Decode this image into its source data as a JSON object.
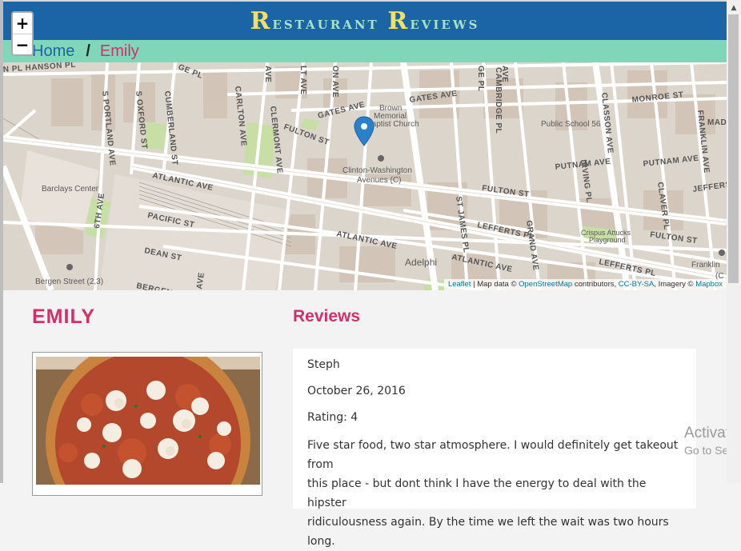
{
  "header": {
    "title_first_caps": [
      "R",
      "R"
    ],
    "title_rest": [
      "estaurant ",
      "eviews"
    ],
    "title": "Restaurant Reviews"
  },
  "breadcrumb": {
    "home": "Home",
    "separator": "/",
    "current": "Emily"
  },
  "map": {
    "zoom_in": "+",
    "zoom_out": "−",
    "attribution": {
      "leaflet": "Leaflet",
      "sep": "|",
      "data_prefix": "Map data ©",
      "osm": "OpenStreetMap",
      "contributors": "contributors,",
      "license": "CC-BY-SA",
      "imagery": ", Imagery ©",
      "provider": "Mapbox"
    },
    "marker_icon": "map-marker-icon",
    "streets": {
      "hanson": "N PL HANSON PL",
      "fulton_w": "FULTON ST",
      "fulton_c": "FULTON ST",
      "fulton_e": "FULTON ST",
      "atlantic_w": "ATLANTIC AVE",
      "atlantic_c": "ATLANTIC AVE",
      "atlantic_e": "ATLANTIC AVE",
      "gates_w": "GATES AVE",
      "gates_e": "GATES AVE",
      "monroe": "MONROE ST",
      "putnam_w": "PUTNAM AVE",
      "putnam_e": "PUTNAM AVE",
      "pacific": "PACIFIC ST",
      "dean": "DEAN ST",
      "bergen": "BERGEN",
      "lefferts_w": "LEFFERTS PL",
      "lefferts_e": "LEFFERTS PL",
      "jefferson": "JEFFERSO",
      "mad": "MAD",
      "s_portland": "S PORTLAND AVE",
      "s_oxford": "S OXFORD ST",
      "cumberland": "CUMBERLAND ST",
      "carlton": "CARLTON AVE",
      "clermont": "CLERMONT AVE",
      "vanderbilt": "VANDERBILT AVE",
      "lt_ave": "LT AVE",
      "on_ave": "ON AVE",
      "st_james": "ST JAMES PL",
      "cambridge": "CAMBRIDGE PL",
      "grand": "GRAND AVE",
      "irving": "IRVING PL",
      "classon": "CLASSON AVE",
      "claver": "CLAVER PL",
      "franklin_ave": "FRANKLIN AVE",
      "sixth": "6TH AVE",
      "ge_pl": "GE PL",
      "ave_top": "AVE"
    },
    "poi": {
      "church_1": "Brown",
      "church_2": "Memorial",
      "church_3": "Baptist Church",
      "school": "Public School 56",
      "barclays": "Barclays Center",
      "station_1": "Clinton-Washington",
      "station_2": "Avenues (C)",
      "bergen_station": "Bergen Street (2,3)",
      "adelphi": "Adelphi",
      "crispus_1": "Crispus Attucks",
      "crispus_2": "Playground",
      "franklin_station": "Franklin",
      "c_label": "(C"
    }
  },
  "restaurant": {
    "name": "EMILY",
    "photo_icon": "pizza-photo"
  },
  "reviews": {
    "title": "Reviews",
    "items": [
      {
        "name": "Steph",
        "date": "October 26, 2016",
        "rating": "Rating: 4",
        "comment_lines": [
          "Five star food, two star atmosphere. I would definitely get takeout from",
          "this place - but dont think I have the energy to deal with the hipster",
          "ridiculousness again. By the time we left the wait was two hours long."
        ]
      }
    ]
  },
  "windows_watermark": {
    "line1": "Activate",
    "line2": "Go to Setti"
  },
  "scrollbar": {
    "up_icon": "scroll-up-arrow-icon"
  }
}
